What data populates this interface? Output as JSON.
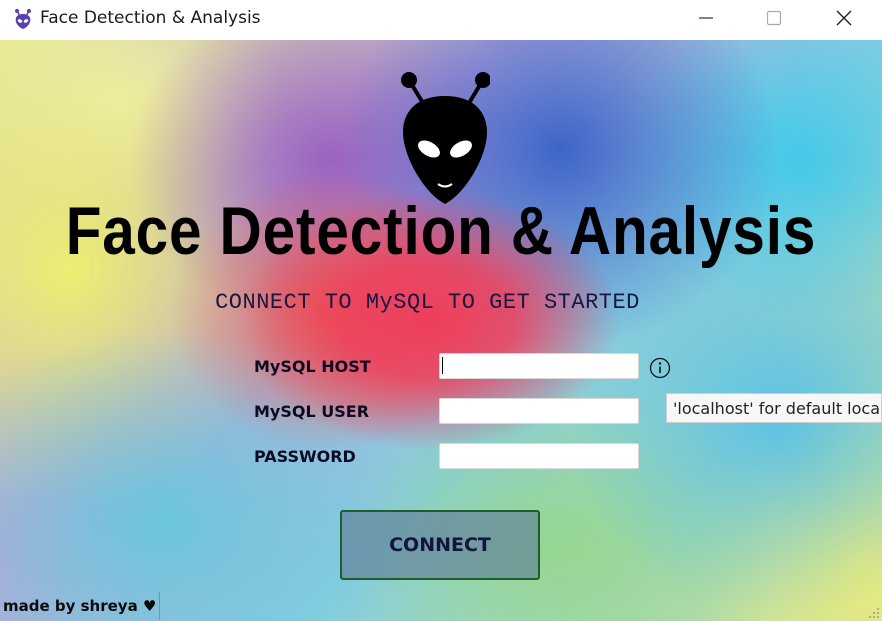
{
  "window": {
    "title": "Face Detection & Analysis",
    "icon": "alien-icon",
    "controls": [
      "minimize-icon",
      "maximize-icon",
      "close-icon"
    ]
  },
  "hero": {
    "logo_icon": "alien-icon",
    "title": "Face Detection & Analysis",
    "subtitle": "CONNECT TO MySQL TO GET STARTED"
  },
  "form": {
    "host": {
      "label": "MySQL HOST",
      "value": "",
      "placeholder": ""
    },
    "user": {
      "label": "MySQL USER",
      "value": "",
      "placeholder": ""
    },
    "password": {
      "label": "PASSWORD",
      "value": "",
      "placeholder": ""
    },
    "info_icon": "info-circle-icon",
    "tooltip": "'localhost' for default local",
    "connect_label": "CONNECT"
  },
  "footer": {
    "credit": "made by shreya ♥"
  },
  "colors": {
    "title_text": "#000000",
    "subtitle_text": "#1b1640",
    "button_border": "#1f5e2a",
    "button_text": "#141440"
  }
}
